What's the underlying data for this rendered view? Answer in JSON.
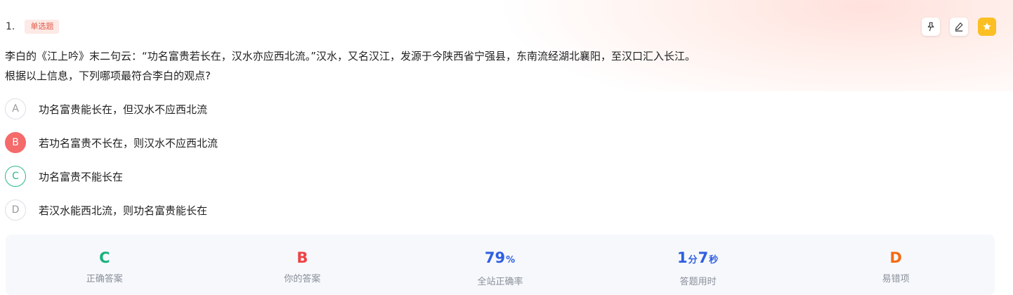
{
  "question": {
    "number": "1.",
    "type_badge": "单选题",
    "stem_line1": "李白的《江上吟》末二句云：“功名富贵若长在，汉水亦应西北流。”汉水，又名汉江，发源于今陕西省宁强县，东南流经湖北襄阳，至汉口汇入长江。",
    "stem_line2": "根据以上信息，下列哪项最符合李白的观点?"
  },
  "tools": {
    "pin_icon": "pin-icon",
    "edit_icon": "edit-icon",
    "favorite_icon": "star-icon",
    "favorite_color": "#fbbf24"
  },
  "options": [
    {
      "letter": "A",
      "text": "功名富贵能长在，但汉水不应西北流",
      "state": "normal"
    },
    {
      "letter": "B",
      "text": "若功名富贵不长在，则汉水不应西北流",
      "state": "chosen"
    },
    {
      "letter": "C",
      "text": "功名富贵不能长在",
      "state": "correct"
    },
    {
      "letter": "D",
      "text": "若汉水能西北流，则功名富贵能长在",
      "state": "normal"
    }
  ],
  "summary": {
    "correct_answer": {
      "value": "C",
      "label": "正确答案"
    },
    "your_answer": {
      "value": "B",
      "label": "你的答案"
    },
    "accuracy": {
      "value": "79",
      "unit": "%",
      "label": "全站正确率"
    },
    "time": {
      "minutes": "1",
      "min_unit": "分",
      "seconds": "7",
      "sec_unit": "秒",
      "label": "答题用时"
    },
    "common_wrong": {
      "value": "D",
      "label": "易错项"
    }
  },
  "colors": {
    "chosen_wrong": "#f56a6a",
    "correct": "#2bb98a",
    "badge_text": "#e35b4b",
    "stat_green": "#18b27c",
    "stat_red": "#ee4343",
    "stat_blue": "#2f5fe0",
    "stat_orange": "#f46b12"
  }
}
